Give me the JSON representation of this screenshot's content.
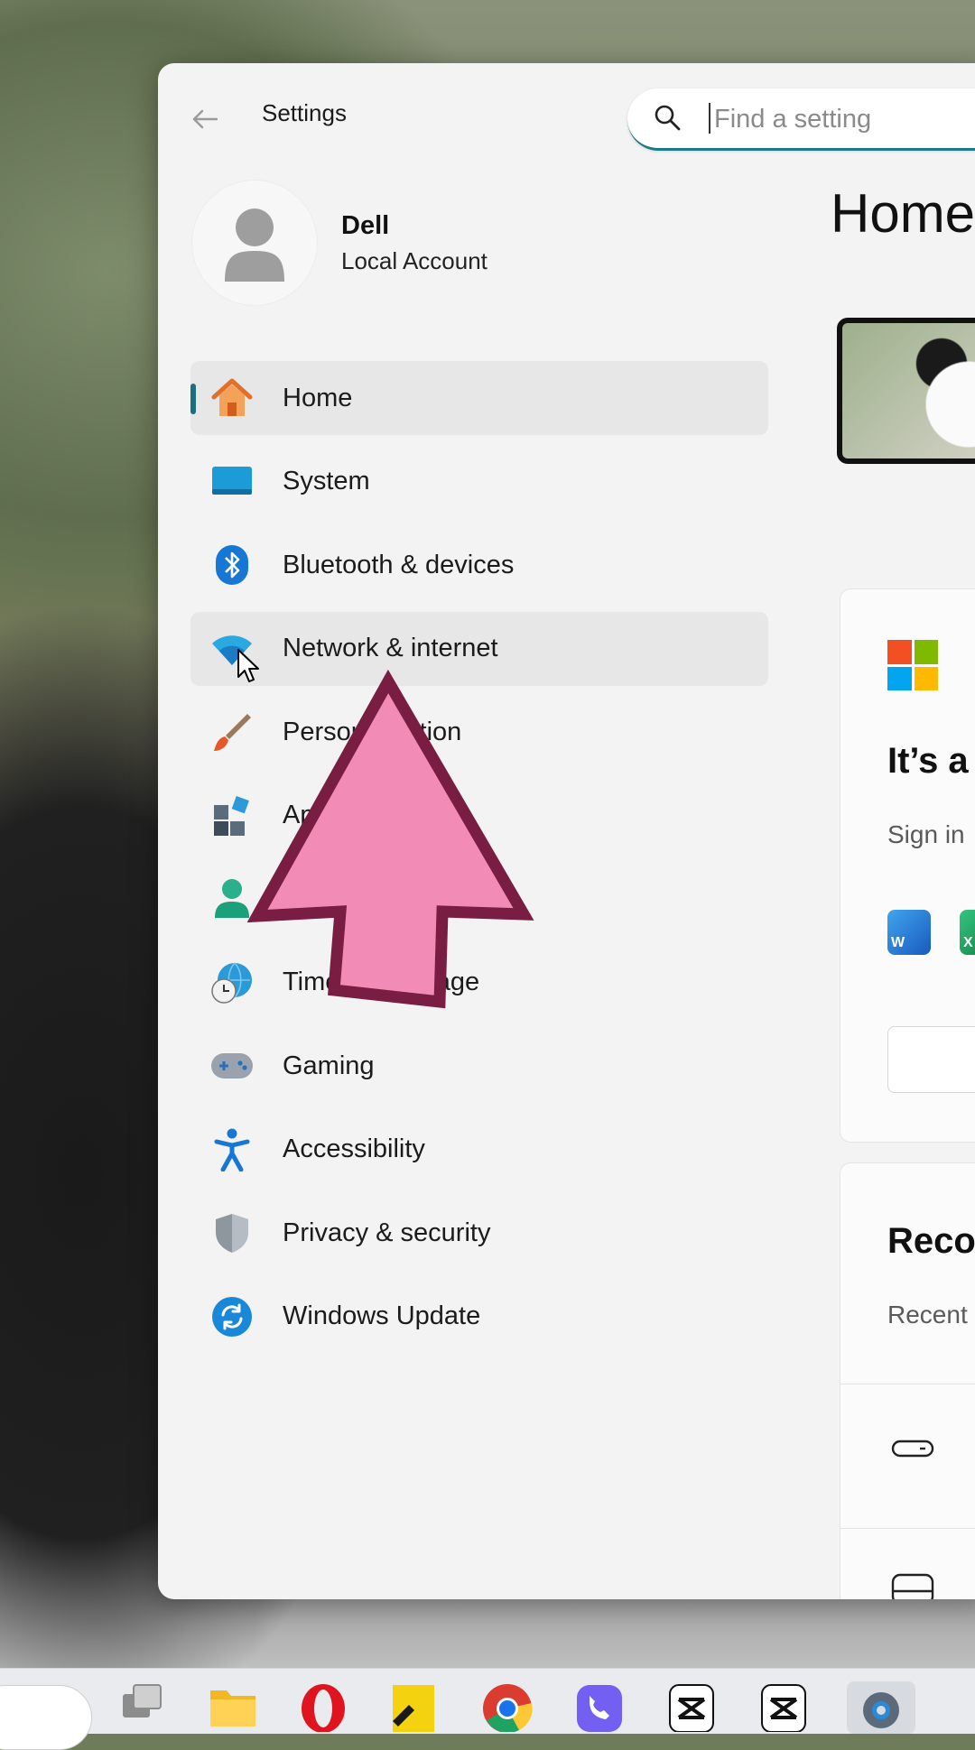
{
  "window": {
    "title": "Settings",
    "back_icon": "arrow-left-icon"
  },
  "search": {
    "placeholder": "Find a setting",
    "value": "",
    "icon": "search-icon"
  },
  "account": {
    "name": "Dell",
    "type": "Local Account"
  },
  "sidebar": {
    "items": [
      {
        "label": "Home",
        "icon": "home-icon",
        "state": "selected"
      },
      {
        "label": "System",
        "icon": "monitor-icon"
      },
      {
        "label": "Bluetooth & devices",
        "icon": "bluetooth-icon"
      },
      {
        "label": "Network & internet",
        "icon": "wifi-icon",
        "state": "hover"
      },
      {
        "label": "Personalization",
        "icon": "paintbrush-icon"
      },
      {
        "label": "Apps",
        "icon": "apps-icon"
      },
      {
        "label": "Accounts",
        "icon": "account-icon"
      },
      {
        "label": "Time & language",
        "icon": "globe-clock-icon"
      },
      {
        "label": "Gaming",
        "icon": "gamepad-icon"
      },
      {
        "label": "Accessibility",
        "icon": "accessibility-icon"
      },
      {
        "label": "Privacy & security",
        "icon": "shield-icon"
      },
      {
        "label": "Windows Update",
        "icon": "update-icon"
      }
    ]
  },
  "main": {
    "title": "Home",
    "card1": {
      "heading": "It’s a",
      "sub": "Sign in"
    },
    "card2": {
      "heading": "Reco",
      "sub": "Recent"
    }
  },
  "overlay": {
    "annotation": "pink-arrow-pointing-up",
    "arrow_fill": "#f28cb6",
    "arrow_stroke": "#7a1d42"
  },
  "colors": {
    "accent": "#1b6f7f",
    "window_bg": "#f3f3f3",
    "selected_bg": "#e7e7e7"
  },
  "taskbar": {
    "items": [
      "search-box",
      "task-view-icon",
      "file-explorer-icon",
      "opera-icon",
      "sticky-notes-icon",
      "chrome-icon",
      "viber-icon",
      "capcut-icon",
      "capcut-icon",
      "settings-icon"
    ]
  }
}
